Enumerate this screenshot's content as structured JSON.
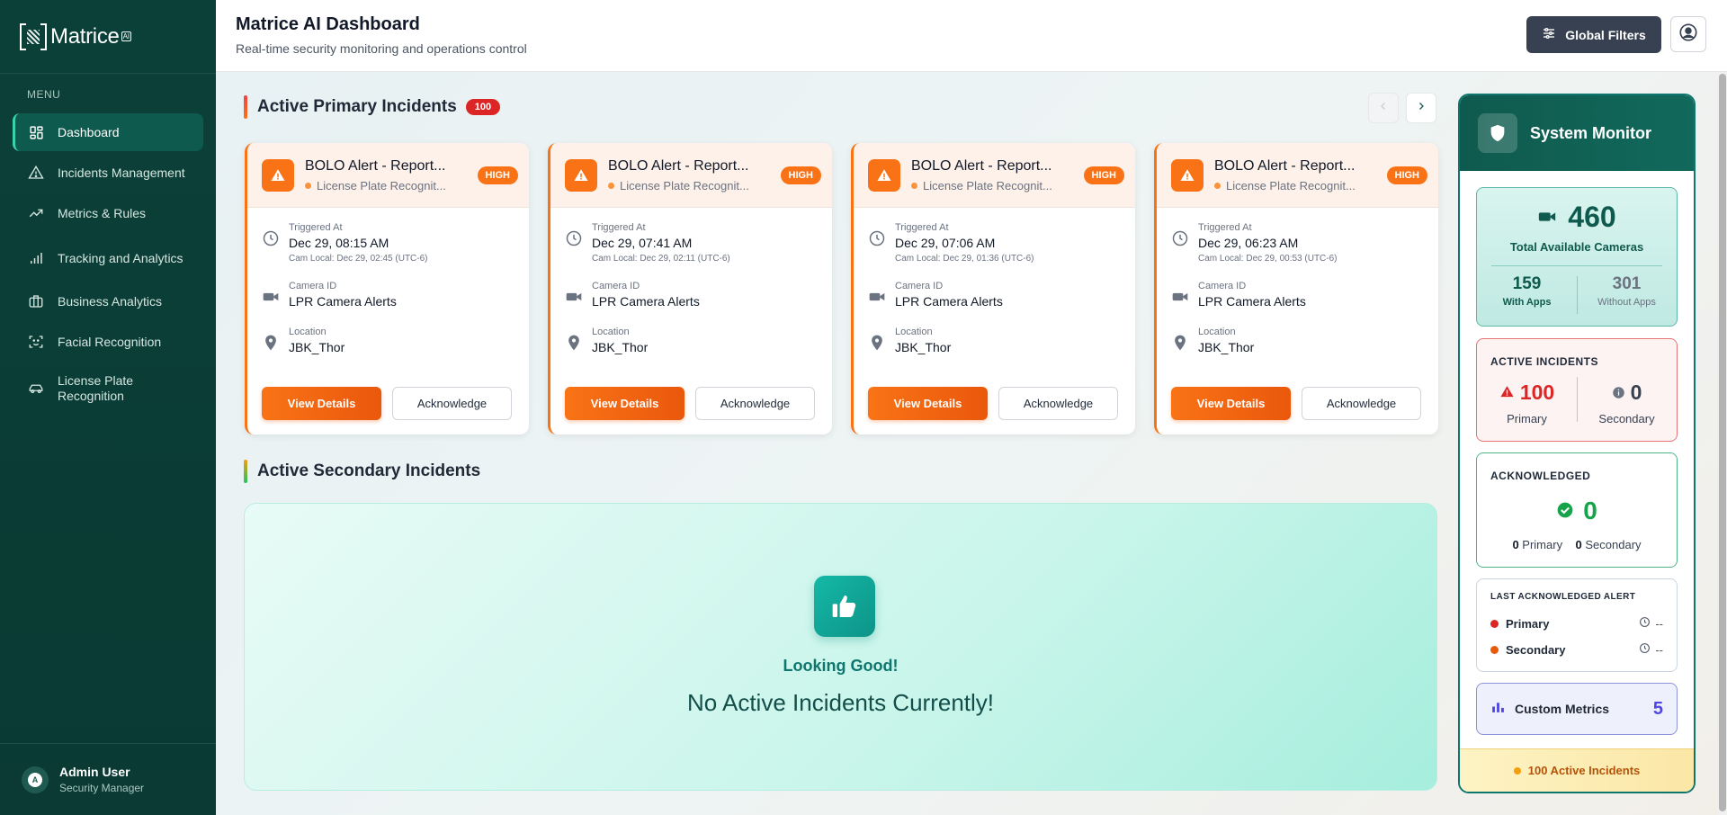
{
  "brand": {
    "name": "Matrice",
    "sup": "AI"
  },
  "sidebar": {
    "menu_label": "MENU",
    "items": [
      {
        "label": "Dashboard",
        "icon": "dashboard-icon"
      },
      {
        "label": "Incidents Management",
        "icon": "warning-icon"
      },
      {
        "label": "Metrics & Rules",
        "icon": "trend-icon"
      },
      {
        "label": "Tracking and Analytics",
        "icon": "bar-chart-icon"
      },
      {
        "label": "Business Analytics",
        "icon": "briefcase-icon"
      },
      {
        "label": "Facial Recognition",
        "icon": "face-scan-icon"
      },
      {
        "label": "License Plate Recognition",
        "icon": "car-icon"
      }
    ],
    "user": {
      "name": "Admin User",
      "role": "Security Manager",
      "initial": "A"
    }
  },
  "header": {
    "title": "Matrice AI Dashboard",
    "subtitle": "Real-time security monitoring and operations control",
    "global_filters": "Global Filters"
  },
  "primary": {
    "title": "Active Primary Incidents",
    "count": "100",
    "cards": [
      {
        "title": "BOLO Alert - Report...",
        "source": "License Plate Recognit...",
        "severity": "HIGH",
        "triggered_label": "Triggered At",
        "triggered": "Dec 29, 08:15 AM",
        "cam_local": "Cam Local: Dec 29, 02:45 (UTC-6)",
        "camera_label": "Camera ID",
        "camera": "LPR Camera Alerts",
        "location_label": "Location",
        "location": "JBK_Thor",
        "view": "View Details",
        "ack": "Acknowledge"
      },
      {
        "title": "BOLO Alert - Report...",
        "source": "License Plate Recognit...",
        "severity": "HIGH",
        "triggered_label": "Triggered At",
        "triggered": "Dec 29, 07:41 AM",
        "cam_local": "Cam Local: Dec 29, 02:11 (UTC-6)",
        "camera_label": "Camera ID",
        "camera": "LPR Camera Alerts",
        "location_label": "Location",
        "location": "JBK_Thor",
        "view": "View Details",
        "ack": "Acknowledge"
      },
      {
        "title": "BOLO Alert - Report...",
        "source": "License Plate Recognit...",
        "severity": "HIGH",
        "triggered_label": "Triggered At",
        "triggered": "Dec 29, 07:06 AM",
        "cam_local": "Cam Local: Dec 29, 01:36 (UTC-6)",
        "camera_label": "Camera ID",
        "camera": "LPR Camera Alerts",
        "location_label": "Location",
        "location": "JBK_Thor",
        "view": "View Details",
        "ack": "Acknowledge"
      },
      {
        "title": "BOLO Alert - Report...",
        "source": "License Plate Recognit...",
        "severity": "HIGH",
        "triggered_label": "Triggered At",
        "triggered": "Dec 29, 06:23 AM",
        "cam_local": "Cam Local: Dec 29, 00:53 (UTC-6)",
        "camera_label": "Camera ID",
        "camera": "LPR Camera Alerts",
        "location_label": "Location",
        "location": "JBK_Thor",
        "view": "View Details",
        "ack": "Acknowledge"
      }
    ]
  },
  "secondary": {
    "title": "Active Secondary Incidents",
    "empty_heading": "Looking Good!",
    "empty_message": "No Active Incidents Currently!"
  },
  "monitor": {
    "title": "System Monitor",
    "cameras": {
      "total": "460",
      "total_label": "Total Available Cameras",
      "with_apps": "159",
      "with_apps_label": "With Apps",
      "without_apps": "301",
      "without_apps_label": "Without Apps"
    },
    "active": {
      "caption": "ACTIVE INCIDENTS",
      "primary": "100",
      "primary_label": "Primary",
      "secondary": "0",
      "secondary_label": "Secondary"
    },
    "acknowledged": {
      "caption": "ACKNOWLEDGED",
      "total": "0",
      "primary_count": "0",
      "primary_label": "Primary",
      "secondary_count": "0",
      "secondary_label": "Secondary"
    },
    "last_ack": {
      "caption": "LAST ACKNOWLEDGED ALERT",
      "primary_label": "Primary",
      "primary_value": "--",
      "secondary_label": "Secondary",
      "secondary_value": "--"
    },
    "custom_metrics": {
      "label": "Custom Metrics",
      "count": "5"
    },
    "footer": "100 Active Incidents"
  },
  "colors": {
    "sidebar": "#0b4038",
    "accent": "#f97316",
    "teal": "#0f766e",
    "danger": "#dc2626",
    "success": "#16a34a",
    "indigo": "#4f46e5"
  }
}
